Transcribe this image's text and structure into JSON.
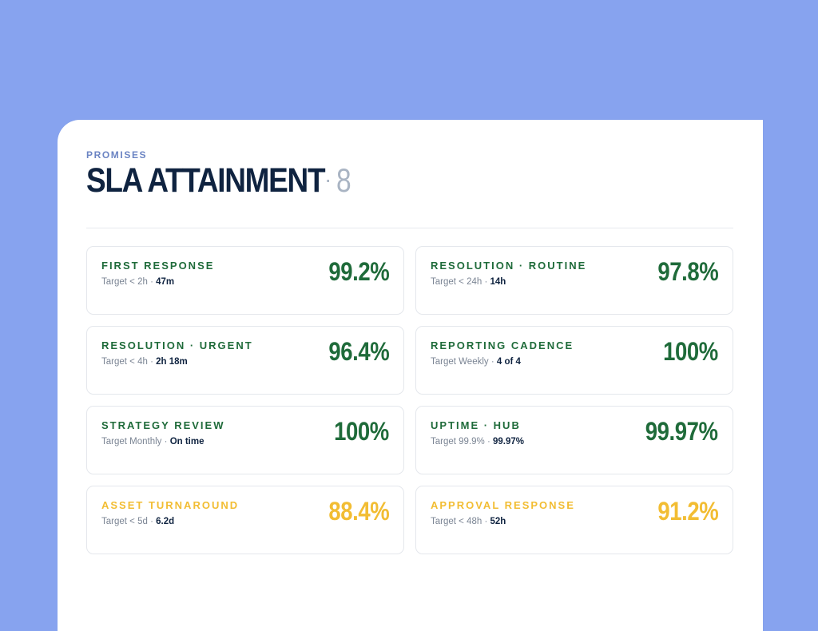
{
  "header": {
    "eyebrow": "PROMISES",
    "title": "SLA ATTAINMENT",
    "separator": "·",
    "count": "8"
  },
  "colors": {
    "background": "#87a3ef",
    "good": "#1f6b3a",
    "warning": "#f2bd33",
    "title": "#0f2340"
  },
  "metrics": [
    {
      "name": "FIRST RESPONSE",
      "target": "Target < 2h",
      "dot": "·",
      "actual": "47m",
      "value": "99.2%",
      "status": "good"
    },
    {
      "name": "RESOLUTION · ROUTINE",
      "target": "Target < 24h",
      "dot": "·",
      "actual": "14h",
      "value": "97.8%",
      "status": "good"
    },
    {
      "name": "RESOLUTION · URGENT",
      "target": "Target < 4h",
      "dot": "·",
      "actual": "2h 18m",
      "value": "96.4%",
      "status": "good"
    },
    {
      "name": "REPORTING CADENCE",
      "target": "Target Weekly",
      "dot": "·",
      "actual": "4 of 4",
      "value": "100%",
      "status": "good"
    },
    {
      "name": "STRATEGY REVIEW",
      "target": "Target Monthly",
      "dot": "·",
      "actual": "On time",
      "value": "100%",
      "status": "good"
    },
    {
      "name": "UPTIME · HUB",
      "target": "Target 99.9%",
      "dot": "·",
      "actual": "99.97%",
      "value": "99.97%",
      "status": "good"
    },
    {
      "name": "ASSET TURNAROUND",
      "target": "Target < 5d",
      "dot": "·",
      "actual": "6.2d",
      "value": "88.4%",
      "status": "warn"
    },
    {
      "name": "APPROVAL RESPONSE",
      "target": "Target < 48h",
      "dot": "·",
      "actual": "52h",
      "value": "91.2%",
      "status": "warn"
    }
  ]
}
